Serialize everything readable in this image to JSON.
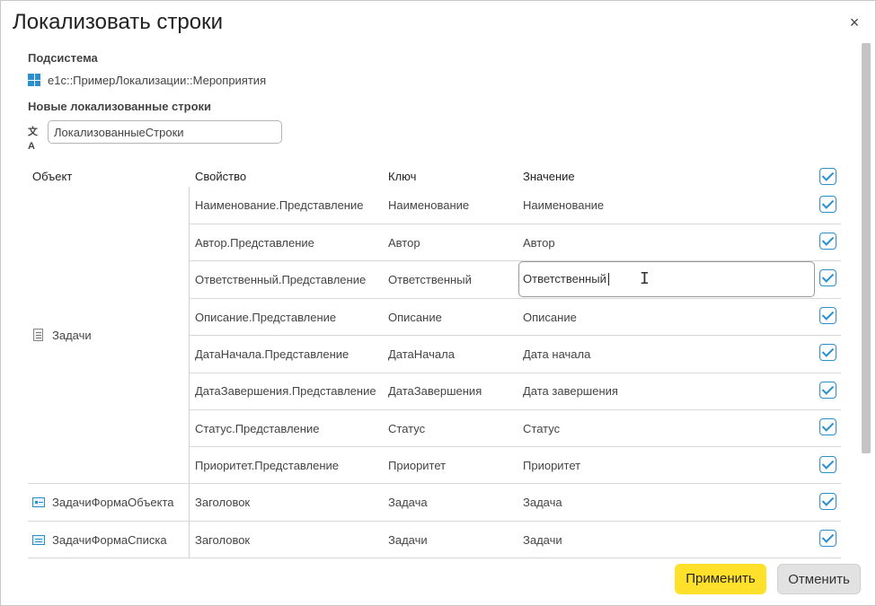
{
  "dialog": {
    "title": "Локализовать строки",
    "close_glyph": "×"
  },
  "subsystem": {
    "label": "Подсистема",
    "value": "e1c::ПримерЛокализации::Мероприятия",
    "icon": "subsystem-grid-icon"
  },
  "new_strings": {
    "label": "Новые локализованные строки",
    "value": "ЛокализованныеСтроки",
    "icon": "translate-icon"
  },
  "table": {
    "headers": {
      "object": "Объект",
      "property": "Свойство",
      "key": "Ключ",
      "value": "Значение"
    },
    "groups": [
      {
        "object": "Задачи",
        "icon": "document-icon",
        "rows": [
          {
            "property": "Наименование.Представление",
            "key": "Наименование",
            "value": "Наименование"
          },
          {
            "property": "Автор.Представление",
            "key": "Автор",
            "value": "Автор"
          },
          {
            "property": "Ответственный.Представление",
            "key": "Ответственный",
            "value": "Ответственный"
          },
          {
            "property": "Описание.Представление",
            "key": "Описание",
            "value": "Описание"
          },
          {
            "property": "ДатаНачала.Представление",
            "key": "ДатаНачала",
            "value": "Дата начала"
          },
          {
            "property": "ДатаЗавершения.Представление",
            "key": "ДатаЗавершения",
            "value": "Дата завершения"
          },
          {
            "property": "Статус.Представление",
            "key": "Статус",
            "value": "Статус"
          },
          {
            "property": "Приоритет.Представление",
            "key": "Приоритет",
            "value": "Приоритет"
          }
        ]
      },
      {
        "object": "ЗадачиФормаОбъекта",
        "icon": "object-form-icon",
        "rows": [
          {
            "property": "Заголовок",
            "key": "Задача",
            "value": "Задача"
          }
        ]
      },
      {
        "object": "ЗадачиФормаСписка",
        "icon": "list-form-icon",
        "rows": [
          {
            "property": "Заголовок",
            "key": "Задачи",
            "value": "Задачи"
          }
        ]
      }
    ]
  },
  "buttons": {
    "apply": "Применить",
    "cancel": "Отменить"
  },
  "colors": {
    "accent": "#2a8fcf",
    "apply_bg": "#ffe02a",
    "cancel_bg": "#e2e2e2"
  }
}
